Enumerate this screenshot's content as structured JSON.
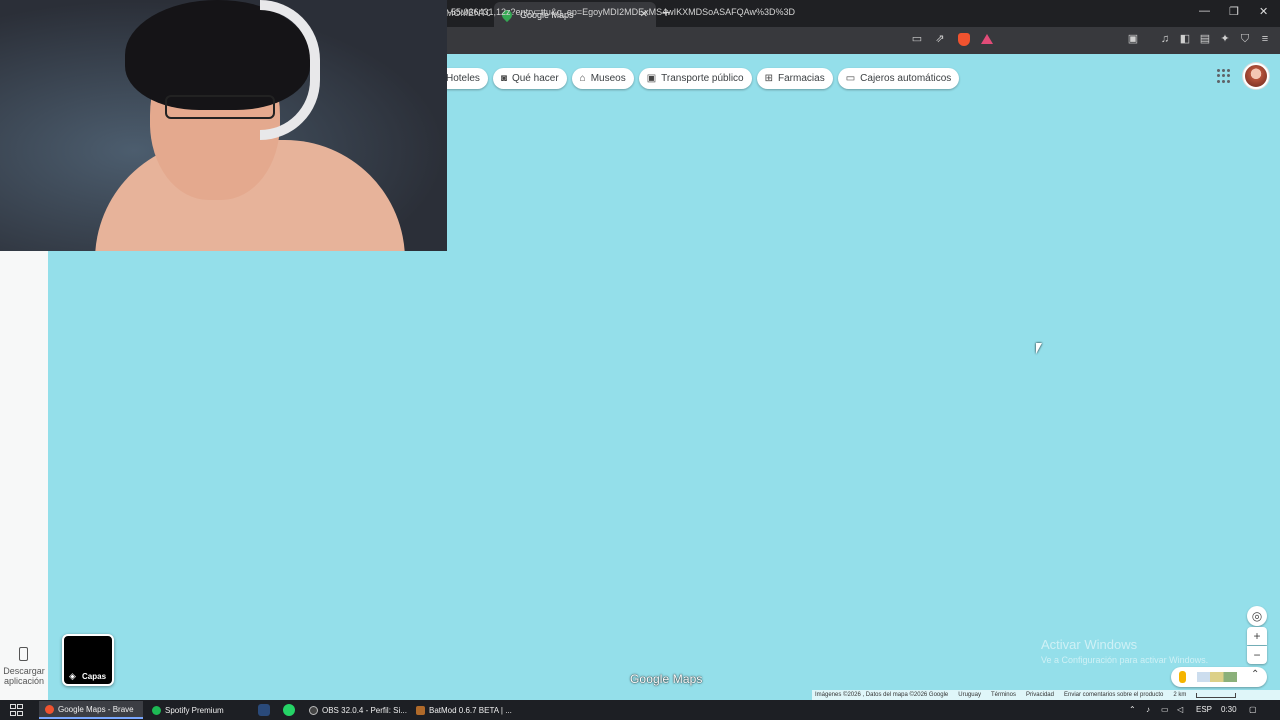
{
  "browser": {
    "prev_tab_label": "MOMENTO",
    "active_tab_title": "Google Maps",
    "url": "-55.036431,12z?entry=ttu&g_ep=EgoyMDI2MDExMS4wIKXMDSoASAFQAw%3D%3D"
  },
  "chips": [
    {
      "label": "Hoteles",
      "icon": "bed-icon"
    },
    {
      "label": "Qué hacer",
      "icon": "camera-icon"
    },
    {
      "label": "Museos",
      "icon": "museum-icon"
    },
    {
      "label": "Transporte público",
      "icon": "bus-icon"
    },
    {
      "label": "Farmacias",
      "icon": "pharmacy-icon"
    },
    {
      "label": "Cajeros automáticos",
      "icon": "atm-icon"
    }
  ],
  "left_rail": {
    "download_label": "Descargar aplicación"
  },
  "layers": {
    "label": "Capas"
  },
  "map": {
    "logo": "Google Maps",
    "water_color": "#94dfea",
    "watermark_title": "Activar Windows",
    "watermark_sub": "Ve a Configuración para activar Windows."
  },
  "footer": {
    "imagery": "Imágenes ©2026 , Datos del mapa ©2026 Google",
    "country": "Uruguay",
    "terms": "Términos",
    "privacy": "Privacidad",
    "feedback": "Enviar comentarios sobre el producto",
    "scale": "2 km"
  },
  "taskbar": {
    "items": [
      "Google Maps - Brave",
      "Spotify Premium",
      "OBS 32.0.4 - Perfil: Si...",
      "BatMod 0.6.7 BETA | ..."
    ],
    "lang": "ESP",
    "time": "0:30"
  }
}
